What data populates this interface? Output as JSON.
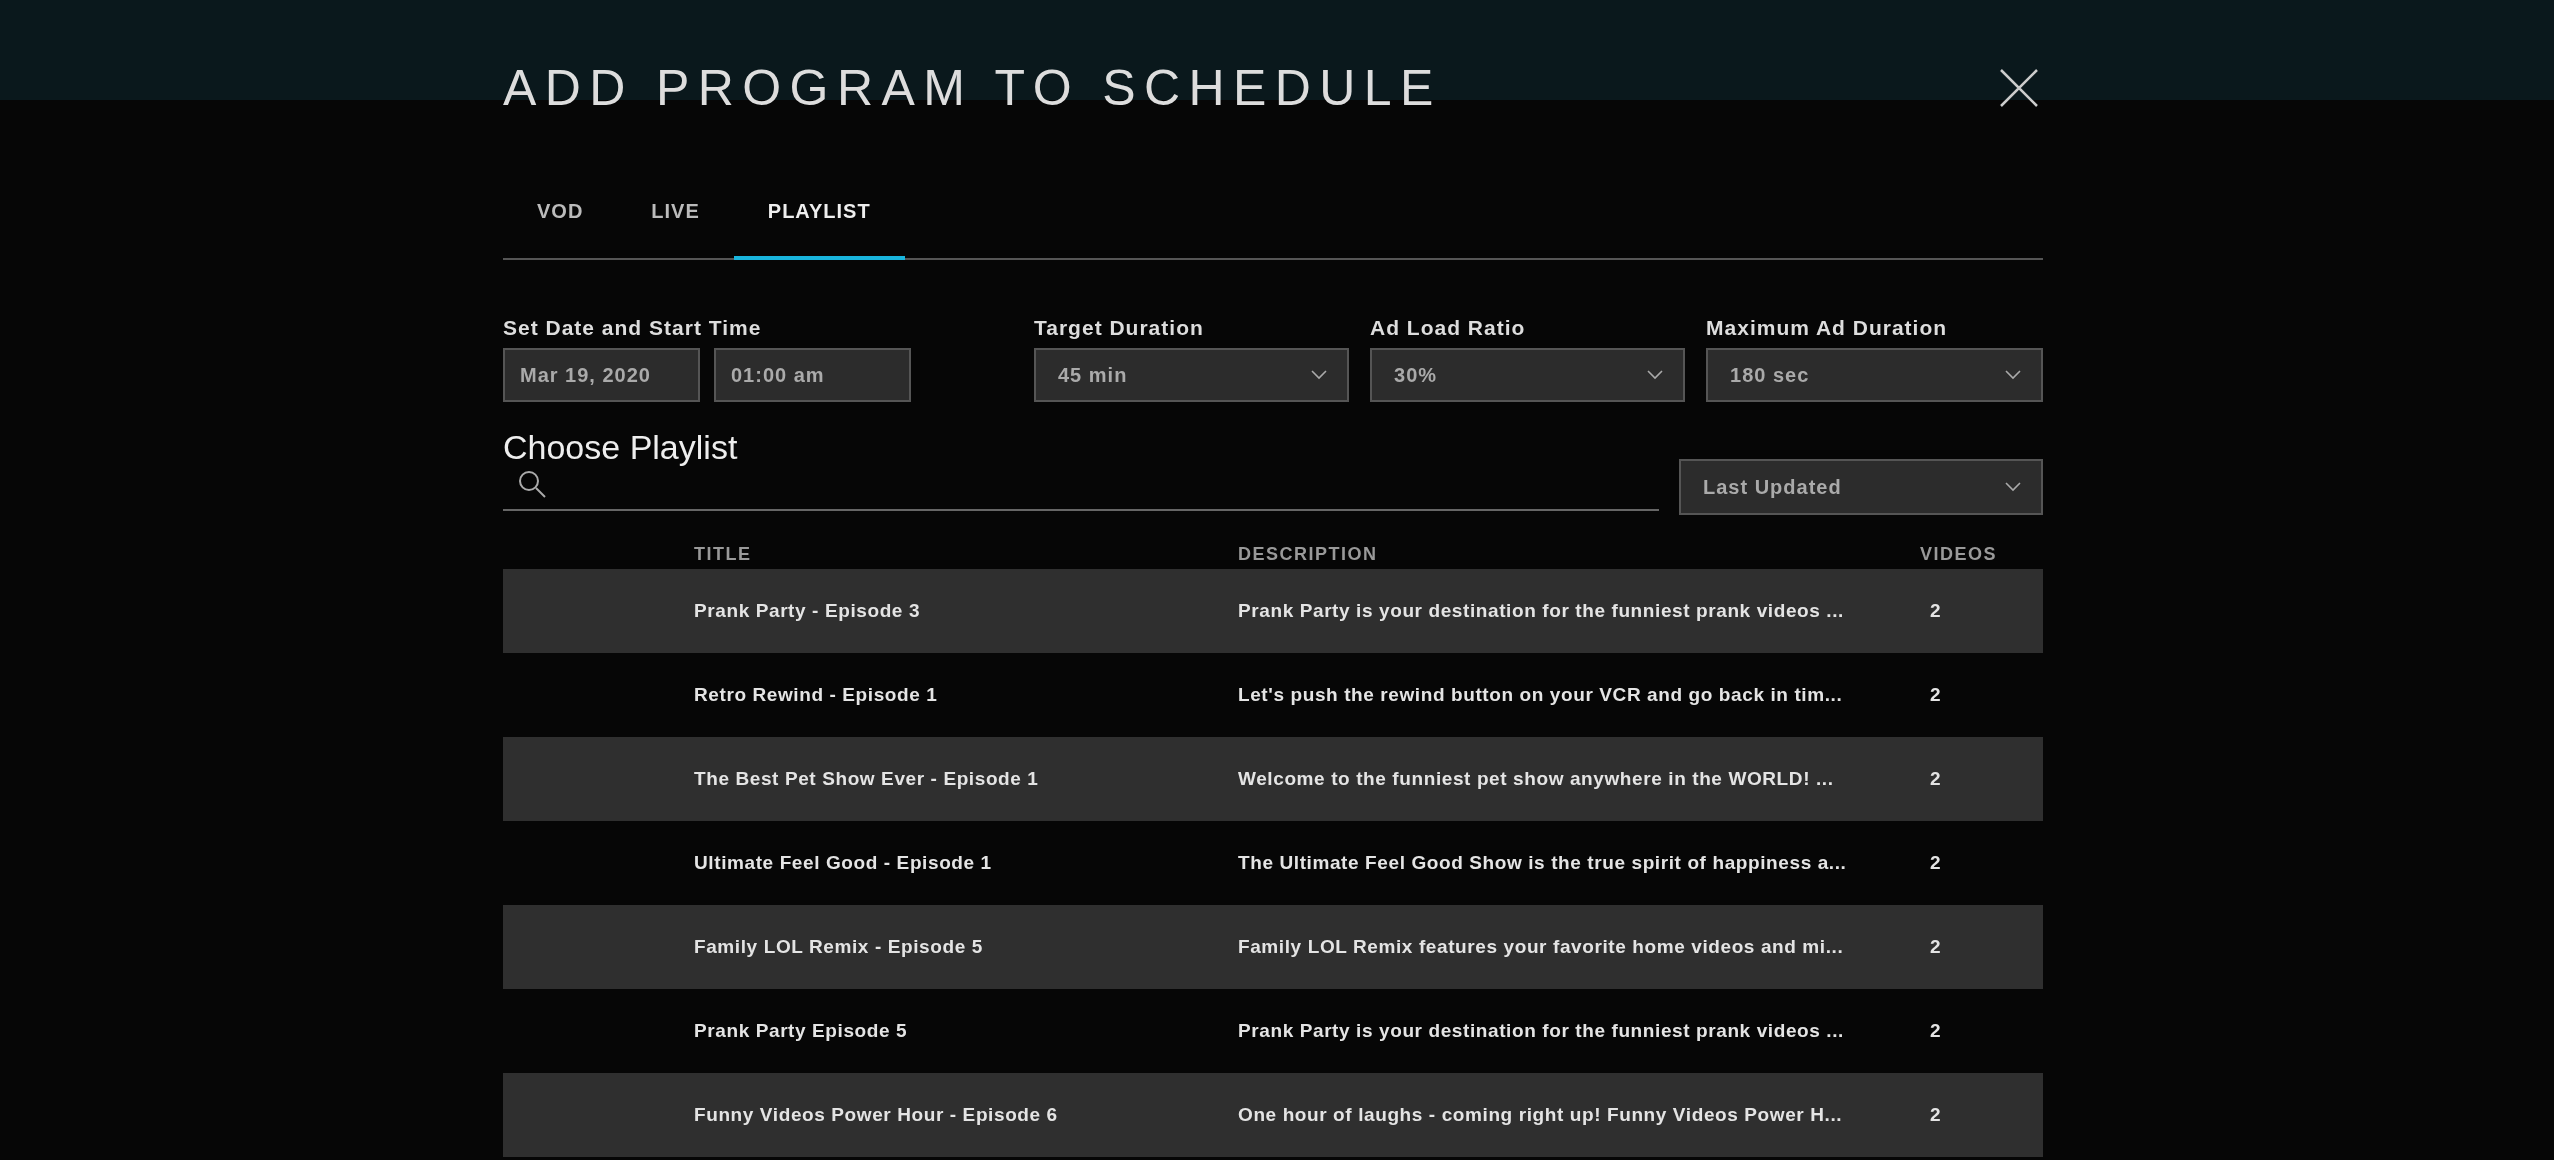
{
  "dialog": {
    "title": "ADD PROGRAM TO SCHEDULE",
    "tabs": [
      {
        "label": "VOD",
        "selected": false
      },
      {
        "label": "LIVE",
        "selected": false
      },
      {
        "label": "PLAYLIST",
        "selected": true
      }
    ],
    "start": {
      "label": "Set Date and Start Time",
      "date": "Mar 19, 2020",
      "time": "01:00 am"
    },
    "selects": [
      {
        "label": "Target Duration",
        "value": "45 min"
      },
      {
        "label": "Ad Load Ratio",
        "value": "30%"
      },
      {
        "label": "Maximum Ad Duration",
        "value": "180 sec"
      }
    ],
    "choose_title": "Choose Playlist",
    "sort": "Last Updated",
    "table": {
      "columns": [
        "TITLE",
        "DESCRIPTION",
        "VIDEOS"
      ],
      "rows": [
        {
          "title": "Prank Party - Episode 3",
          "description": "Prank Party is your destination for the funniest prank videos ...",
          "videos": "2"
        },
        {
          "title": "Retro Rewind - Episode 1",
          "description": "Let's push the rewind button on your VCR and go back in tim...",
          "videos": "2"
        },
        {
          "title": "The Best Pet Show Ever - Episode 1",
          "description": "Welcome to the funniest pet show anywhere in the WORLD! ...",
          "videos": "2"
        },
        {
          "title": "Ultimate Feel Good - Episode 1",
          "description": "The Ultimate Feel Good Show is the true spirit of happiness a...",
          "videos": "2"
        },
        {
          "title": "Family LOL Remix - Episode 5",
          "description": "Family LOL Remix features your favorite home videos and mi...",
          "videos": "2"
        },
        {
          "title": "Prank Party Episode 5",
          "description": "Prank Party is your destination for the funniest prank videos ...",
          "videos": "2"
        },
        {
          "title": "Funny Videos Power Hour - Episode 6",
          "description": "One hour of laughs - coming right up! Funny Videos Power H...",
          "videos": "2"
        }
      ]
    }
  }
}
